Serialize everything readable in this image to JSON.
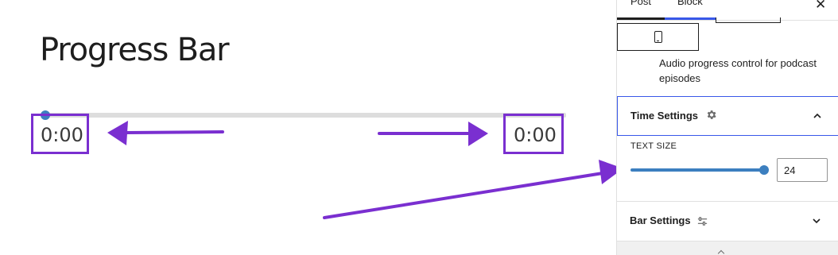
{
  "editor": {
    "title": "Progress Bar",
    "progress": 0.0,
    "current_time": "0:00",
    "total_time": "0:00"
  },
  "sidebar": {
    "tabs": [
      {
        "label": "Post",
        "active": false
      },
      {
        "label": "Block",
        "active": true
      }
    ],
    "close_icon": "close-icon",
    "device_icon": "mobile-device-icon",
    "description": "Audio progress control for podcast episodes",
    "time_settings": {
      "title": "Time Settings",
      "icon": "gear-icon",
      "expanded": true,
      "text_size_label": "TEXT SIZE",
      "text_size_value": "24",
      "text_size_fraction": 1.0
    },
    "bar_settings": {
      "title": "Bar Settings",
      "icon": "sliders-icon",
      "expanded": false
    }
  },
  "colors": {
    "accent": "#3858e9",
    "range": "#3c7fbf",
    "annotation": "#7a2fd0"
  }
}
